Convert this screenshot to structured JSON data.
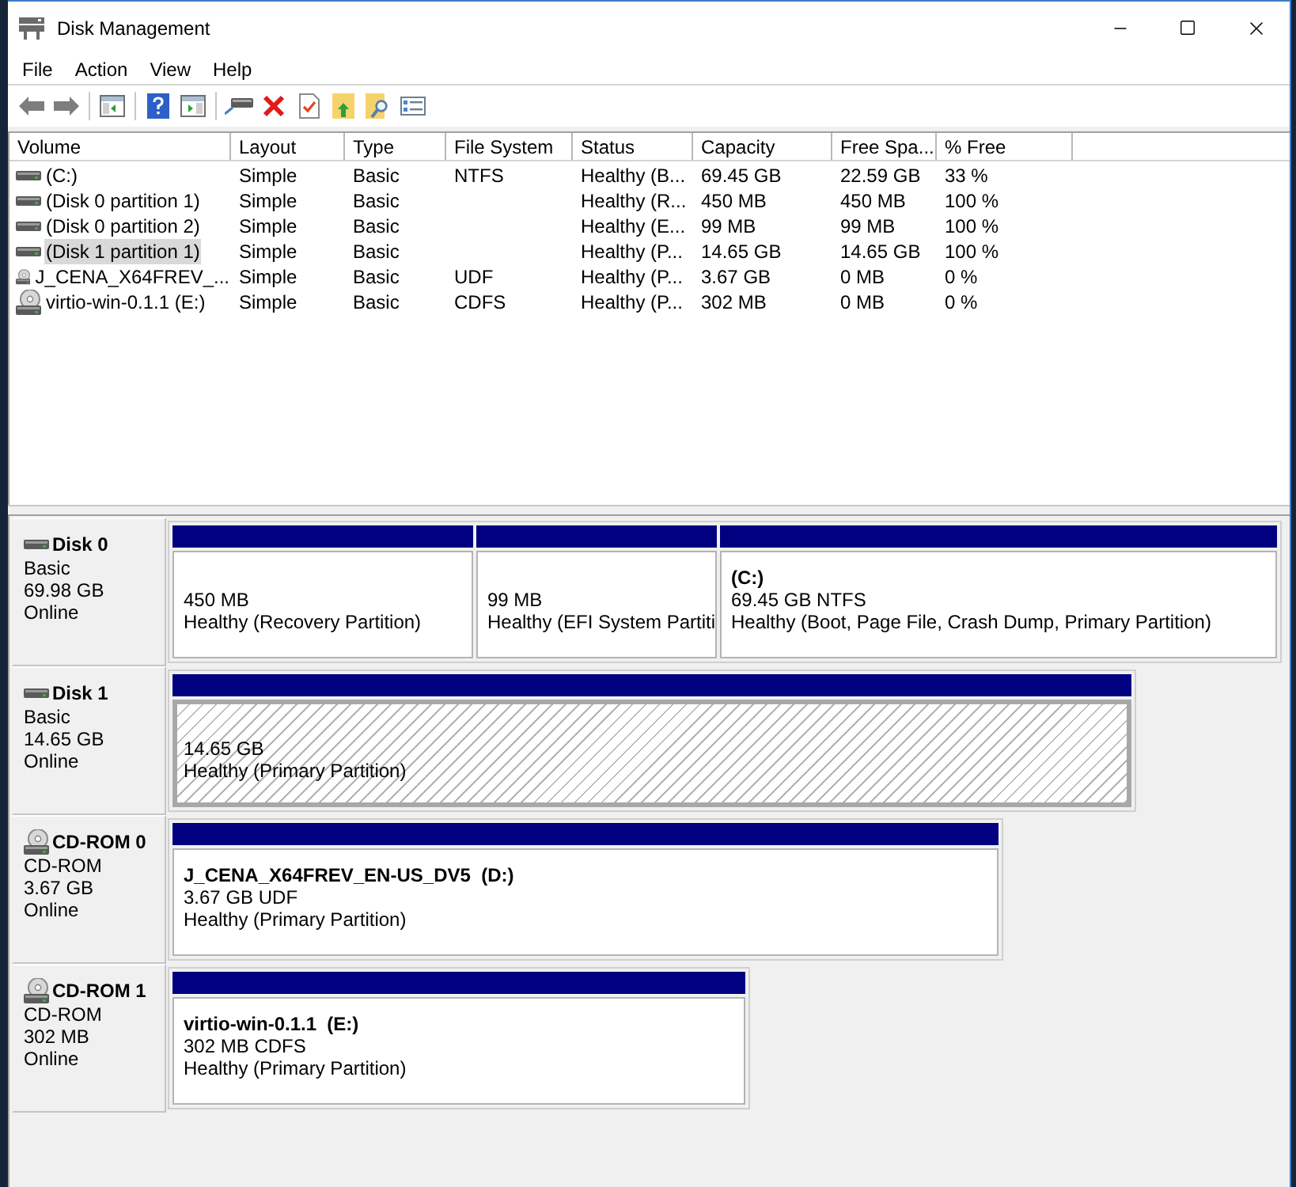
{
  "window": {
    "title": "Disk Management"
  },
  "menu": [
    "File",
    "Action",
    "View",
    "Help"
  ],
  "volume_list": {
    "columns": [
      "Volume",
      "Layout",
      "Type",
      "File System",
      "Status",
      "Capacity",
      "Free Spa...",
      "% Free"
    ],
    "rows": [
      {
        "kind": "disk",
        "selected": false,
        "cells": [
          "(C:)",
          "Simple",
          "Basic",
          "NTFS",
          "Healthy (B...",
          "69.45 GB",
          "22.59 GB",
          "33 %"
        ]
      },
      {
        "kind": "disk",
        "selected": false,
        "cells": [
          "(Disk 0 partition 1)",
          "Simple",
          "Basic",
          null,
          "Healthy (R...",
          "450 MB",
          "450 MB",
          "100 %"
        ]
      },
      {
        "kind": "disk",
        "selected": false,
        "cells": [
          "(Disk 0 partition 2)",
          "Simple",
          "Basic",
          null,
          "Healthy (E...",
          "99 MB",
          "99 MB",
          "100 %"
        ]
      },
      {
        "kind": "disk",
        "selected": true,
        "cells": [
          "(Disk 1 partition 1)",
          "Simple",
          "Basic",
          null,
          "Healthy (P...",
          "14.65 GB",
          "14.65 GB",
          "100 %"
        ]
      },
      {
        "kind": "cd",
        "selected": false,
        "cells": [
          "J_CENA_X64FREV_...",
          "Simple",
          "Basic",
          "UDF",
          "Healthy (P...",
          "3.67 GB",
          "0 MB",
          "0 %"
        ]
      },
      {
        "kind": "cd",
        "selected": false,
        "cells": [
          "virtio-win-0.1.1 (E:)",
          "Simple",
          "Basic",
          "CDFS",
          "Healthy (P...",
          "302 MB",
          "0 MB",
          "0 %"
        ]
      }
    ]
  },
  "disks": [
    {
      "kind": "disk",
      "name": "Disk 0",
      "type": "Basic",
      "size": "69.98 GB",
      "status": "Online",
      "partitions": [
        {
          "size": "450 MB",
          "status": "Healthy (Recovery Partition)",
          "selected": false
        },
        {
          "size": "99 MB",
          "status": "Healthy (EFI System Partiti",
          "selected": false
        },
        {
          "label": "(C:)",
          "size": "69.45 GB NTFS",
          "status": "Healthy (Boot, Page File, Crash Dump, Primary Partition)",
          "selected": false
        }
      ]
    },
    {
      "kind": "disk",
      "name": "Disk 1",
      "type": "Basic",
      "size": "14.65 GB",
      "status": "Online",
      "partitions": [
        {
          "size": "14.65 GB",
          "status": "Healthy (Primary Partition)",
          "selected": true
        }
      ]
    },
    {
      "kind": "cd",
      "name": "CD-ROM 0",
      "type": "CD-ROM",
      "size": "3.67 GB",
      "status": "Online",
      "partitions": [
        {
          "label": "J_CENA_X64FREV_EN-US_DV5  (D:)",
          "size": "3.67 GB UDF",
          "status": "Healthy (Primary Partition)",
          "selected": false
        }
      ]
    },
    {
      "kind": "cd",
      "name": "CD-ROM 1",
      "type": "CD-ROM",
      "size": "302 MB",
      "status": "Online",
      "partitions": [
        {
          "label": "virtio-win-0.1.1  (E:)",
          "size": "302 MB CDFS",
          "status": "Healthy (Primary Partition)",
          "selected": false
        }
      ]
    }
  ]
}
